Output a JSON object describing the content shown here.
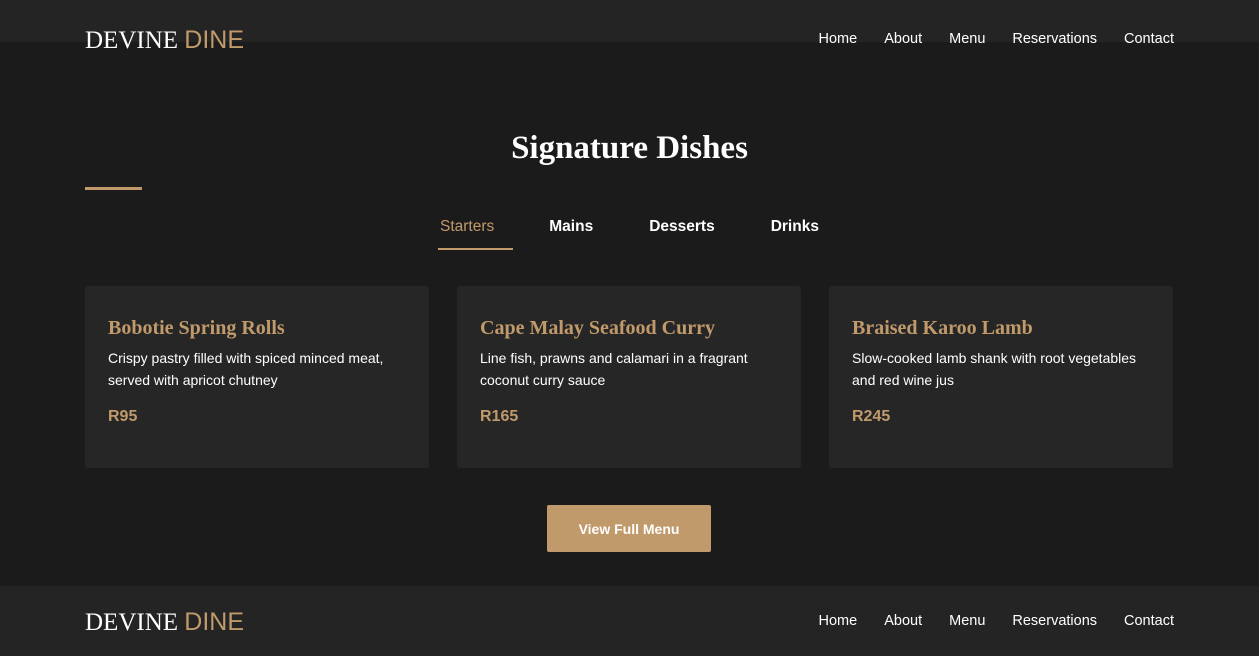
{
  "header": {
    "brand_main": "DEVINE",
    "brand_accent": "DINE",
    "nav": [
      "Home",
      "About",
      "Menu",
      "Reservations",
      "Contact"
    ]
  },
  "section": {
    "title": "Signature Dishes",
    "tabs": [
      "Starters",
      "Mains",
      "Desserts",
      "Drinks"
    ],
    "active_tab": "Starters"
  },
  "dishes": [
    {
      "name": "Bobotie Spring Rolls",
      "description": "Crispy pastry filled with spiced minced meat, served with apricot chutney",
      "price": "R95"
    },
    {
      "name": "Cape Malay Seafood Curry",
      "description": "Line fish, prawns and calamari in a fragrant coconut curry sauce",
      "price": "R165"
    },
    {
      "name": "Braised Karoo Lamb",
      "description": "Slow-cooked lamb shank with root vegetables and red wine jus",
      "price": "R245"
    }
  ],
  "cta_label": "View Full Menu",
  "footer": {
    "brand_main": "DEVINE",
    "brand_accent": "DINE",
    "nav": [
      "Home",
      "About",
      "Menu",
      "Reservations",
      "Contact"
    ]
  },
  "colors": {
    "background": "#1b1b1b",
    "card": "#262626",
    "accent": "#c19a6b"
  }
}
